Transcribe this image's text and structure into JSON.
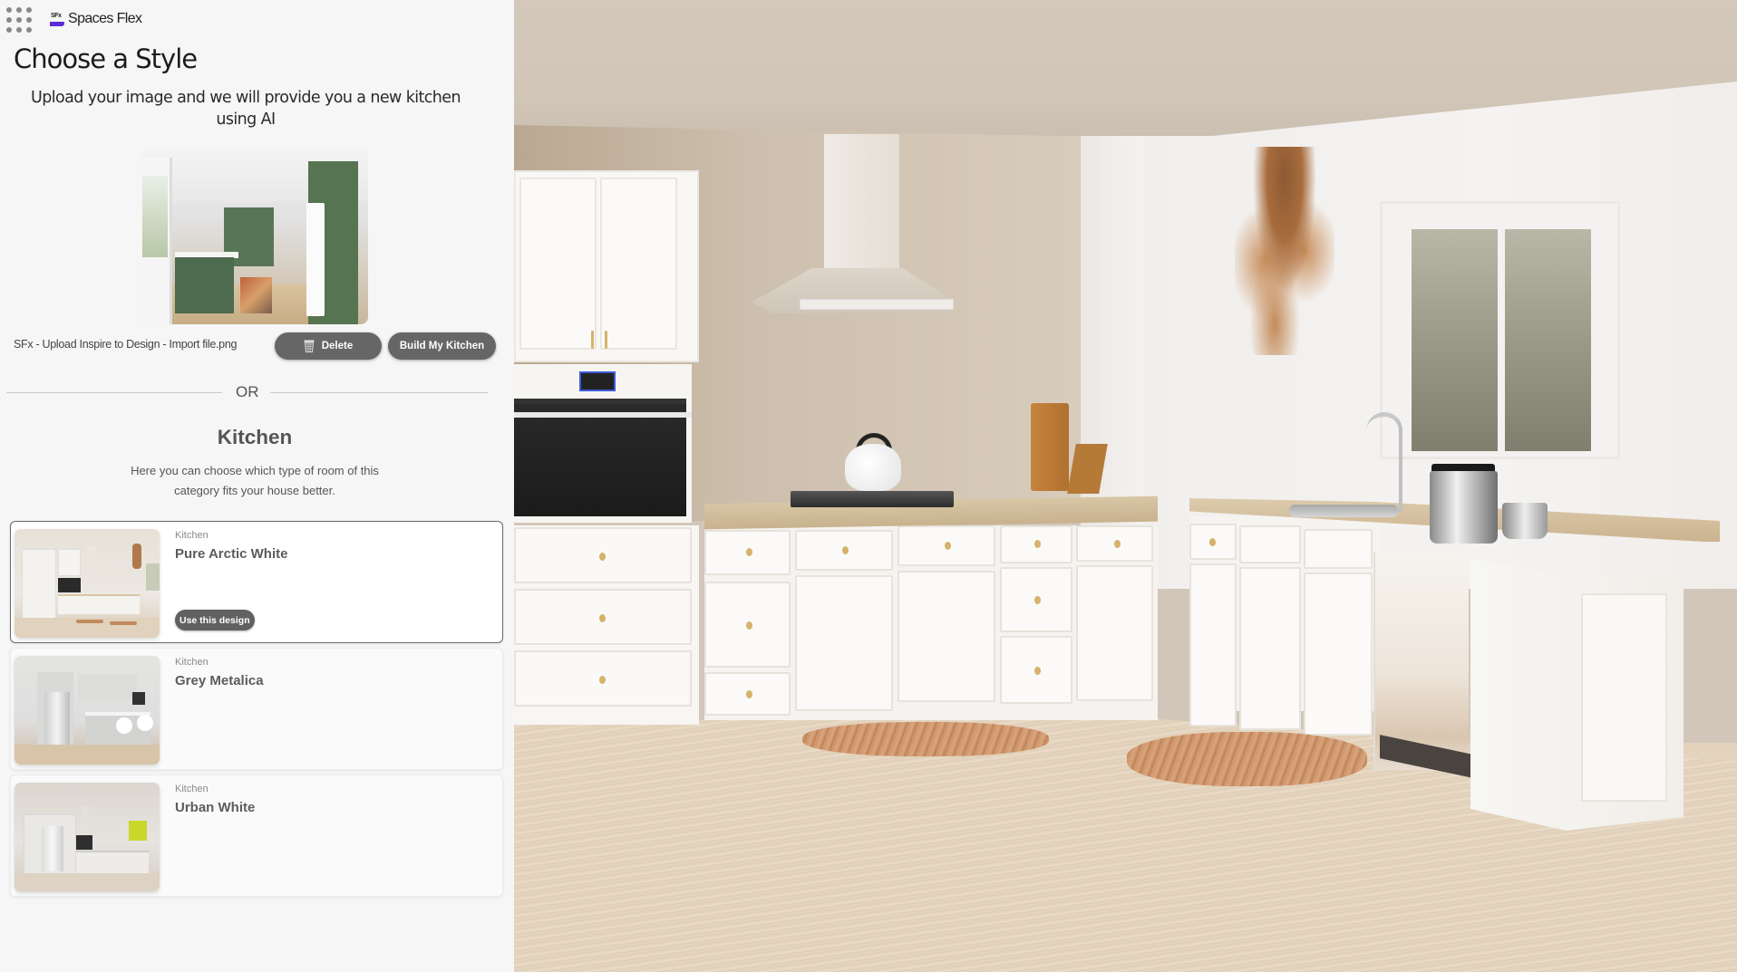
{
  "app": {
    "brand_mark": "SFx",
    "brand_name": "Spaces Flex",
    "apps_icon": "grid-dots-icon"
  },
  "header": {
    "title": "Choose a Style",
    "subtitle": "Upload your image and we will provide you a new kitchen using AI"
  },
  "upload": {
    "preview_alt": "Uploaded green kitchen photo",
    "file_name": "SFx - Upload Inspire to Design - Import file.png",
    "delete_label": "Delete",
    "delete_icon": "trash-icon",
    "build_label": "Build My Kitchen"
  },
  "divider": {
    "label": "OR"
  },
  "category": {
    "title": "Kitchen",
    "description": "Here you can choose which type of room of this category fits your house better."
  },
  "designs": [
    {
      "category": "Kitchen",
      "name": "Pure Arctic White",
      "selected": true,
      "action_label": "Use this design"
    },
    {
      "category": "Kitchen",
      "name": "Grey Metalica",
      "selected": false
    },
    {
      "category": "Kitchen",
      "name": "Urban White",
      "selected": false
    }
  ],
  "colors": {
    "sidebar_bg": "#f6f6f6",
    "button_bg": "#666666",
    "brand_accent": "#5b2bd9",
    "selected_border": "#6a6a6a"
  },
  "main_view": {
    "description": "Rendered kitchen preview: Pure Arctic White"
  }
}
